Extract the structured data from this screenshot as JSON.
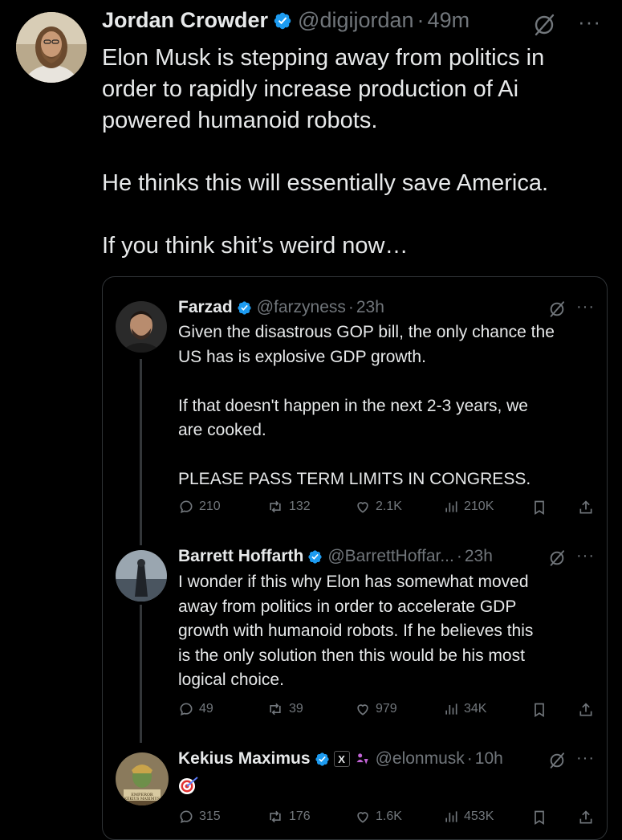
{
  "tweet": {
    "author_name": "Jordan Crowder",
    "handle": "@digijordan",
    "time": "49m",
    "text": "Elon Musk is stepping away from politics in\norder to rapidly increase production of Ai\npowered humanoid robots.\n\nHe thinks this will essentially save America.\n\nIf you think shit’s weird now…"
  },
  "quote": {
    "tweets": [
      {
        "author_name": "Farzad",
        "handle": "@farzyness",
        "time": "23h",
        "text": "Given the disastrous GOP bill, the only chance the\nUS has is explosive GDP growth.\n\nIf that doesn't happen in the next 2-3 years, we\nare cooked.\n\nPLEASE PASS TERM LIMITS IN CONGRESS.",
        "replies": "210",
        "reposts": "132",
        "likes": "2.1K",
        "views": "210K"
      },
      {
        "author_name": "Barrett Hoffarth",
        "handle": "@BarrettHoffar...",
        "time": "23h",
        "text": "I wonder if this why Elon has somewhat moved\naway from politics in order to accelerate GDP\ngrowth with humanoid robots. If he believes this\nis the only solution then this would be his most\nlogical choice.",
        "replies": "49",
        "reposts": "39",
        "likes": "979",
        "views": "34K"
      },
      {
        "author_name": "Kekius Maximus",
        "handle": "@elonmusk",
        "time": "10h",
        "x_badge": "X",
        "avatar_caption": "EMPEROR KEKIUS MAXIMUS",
        "replies": "315",
        "reposts": "176",
        "likes": "1.6K",
        "views": "453K"
      }
    ]
  },
  "colors": {
    "background": "#000000",
    "text": "#e7e9ea",
    "muted": "#71767b",
    "verified": "#1d9bf0"
  }
}
